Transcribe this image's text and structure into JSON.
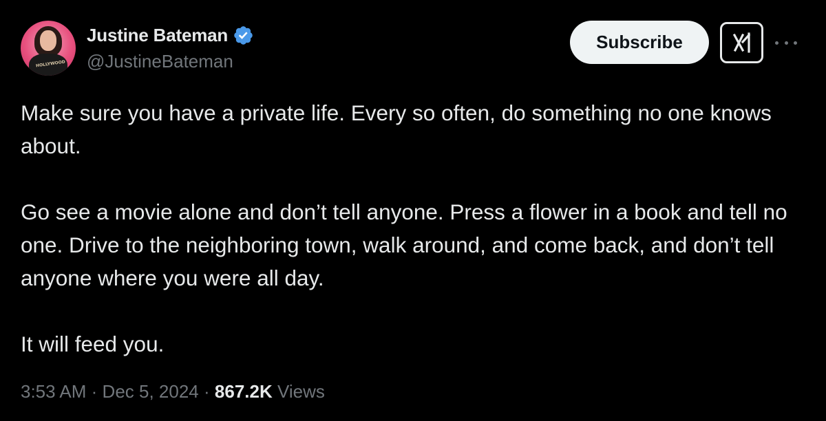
{
  "author": {
    "display_name": "Justine Bateman",
    "handle": "@JustineBateman",
    "verified_color": "#4a99e9",
    "avatar_shirt_text": "HOLLYWOOD"
  },
  "actions": {
    "subscribe_label": "Subscribe",
    "grok_icon": "grok-icon",
    "more_icon": "more-icon"
  },
  "tweet": {
    "paragraphs": [
      "Make sure you have a private life. Every so often, do something no one knows about.",
      "Go see a movie alone and don’t tell anyone. Press a flower in a book and tell no one. Drive to the neighboring town, walk around, and come back, and don’t tell anyone where you were all day.",
      "It will feed you."
    ]
  },
  "meta": {
    "time": "3:53 AM",
    "separator": "·",
    "date": "Dec 5, 2024",
    "views_count": "867.2K",
    "views_label": "Views"
  },
  "colors": {
    "background": "#000000",
    "text": "#e7e9ea",
    "secondary": "#71767b",
    "button_bg": "#eff3f4"
  }
}
